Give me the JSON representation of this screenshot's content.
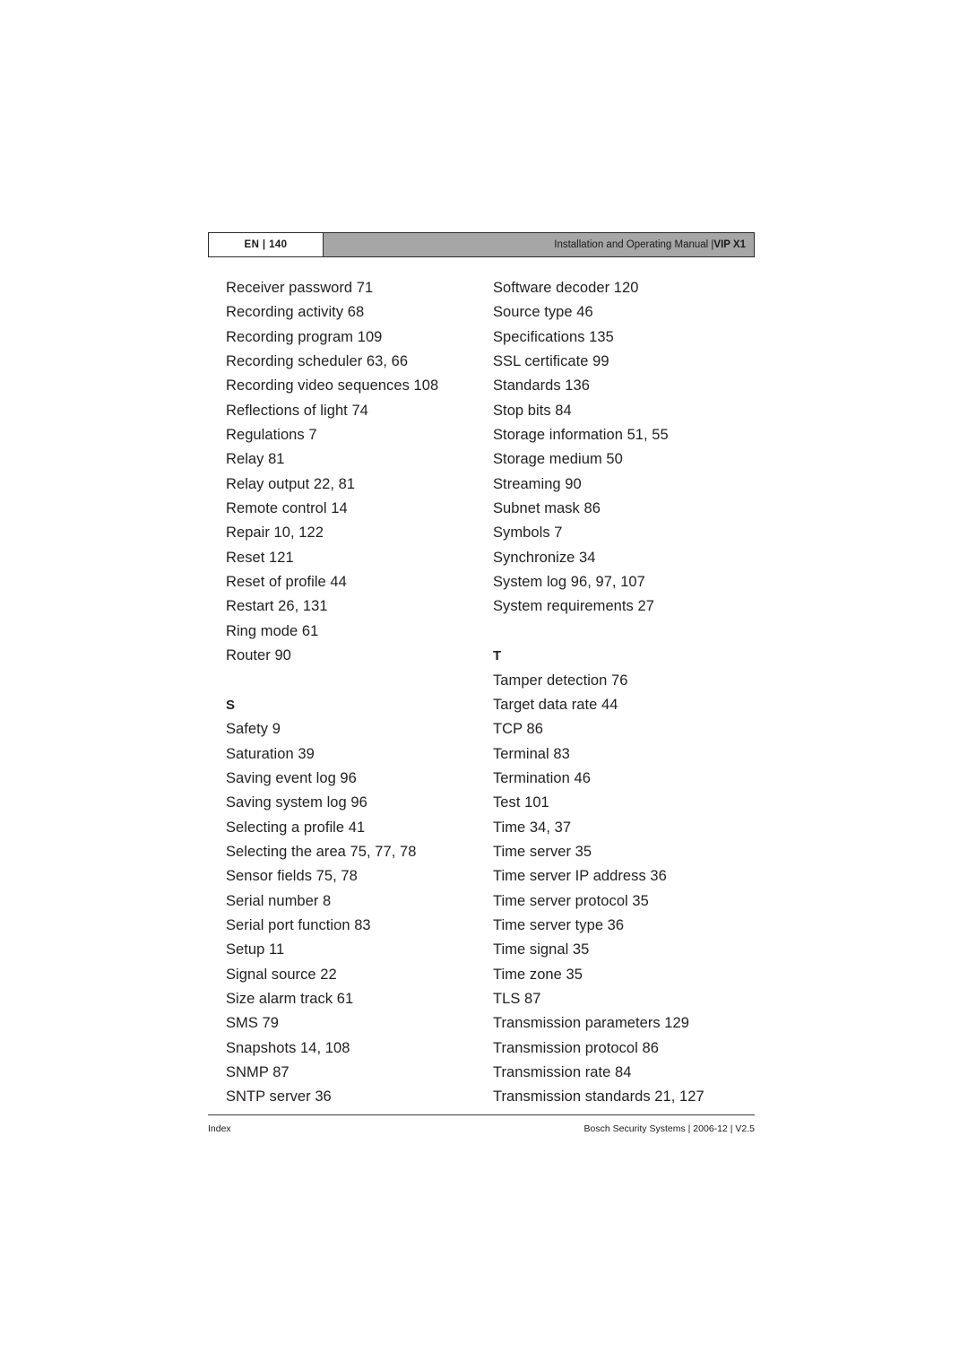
{
  "header": {
    "language_page": "EN | 140",
    "manual_title": "Installation and Operating Manual |",
    "product": "VIP X1"
  },
  "index": {
    "left_column": [
      {
        "type": "entry",
        "text": "Receiver password 71"
      },
      {
        "type": "entry",
        "text": "Recording activity 68"
      },
      {
        "type": "entry",
        "text": "Recording program 109"
      },
      {
        "type": "entry",
        "text": "Recording scheduler 63, 66"
      },
      {
        "type": "entry",
        "text": "Recording video sequences 108"
      },
      {
        "type": "entry",
        "text": "Reflections of light 74"
      },
      {
        "type": "entry",
        "text": "Regulations 7"
      },
      {
        "type": "entry",
        "text": "Relay 81"
      },
      {
        "type": "entry",
        "text": "Relay output 22, 81"
      },
      {
        "type": "entry",
        "text": "Remote control 14"
      },
      {
        "type": "entry",
        "text": "Repair 10, 122"
      },
      {
        "type": "entry",
        "text": "Reset 121"
      },
      {
        "type": "entry",
        "text": "Reset of profile 44"
      },
      {
        "type": "entry",
        "text": "Restart 26, 131"
      },
      {
        "type": "entry",
        "text": "Ring mode 61"
      },
      {
        "type": "entry",
        "text": "Router 90"
      },
      {
        "type": "heading",
        "text": "S"
      },
      {
        "type": "entry",
        "text": "Safety 9"
      },
      {
        "type": "entry",
        "text": "Saturation 39"
      },
      {
        "type": "entry",
        "text": "Saving event log 96"
      },
      {
        "type": "entry",
        "text": "Saving system log 96"
      },
      {
        "type": "entry",
        "text": "Selecting a profile 41"
      },
      {
        "type": "entry",
        "text": "Selecting the area 75, 77, 78"
      },
      {
        "type": "entry",
        "text": "Sensor fields 75, 78"
      },
      {
        "type": "entry",
        "text": "Serial number 8"
      },
      {
        "type": "entry",
        "text": "Serial port function 83"
      },
      {
        "type": "entry",
        "text": "Setup 11"
      },
      {
        "type": "entry",
        "text": "Signal source 22"
      },
      {
        "type": "entry",
        "text": "Size alarm track 61"
      },
      {
        "type": "entry",
        "text": "SMS 79"
      },
      {
        "type": "entry",
        "text": "Snapshots 14, 108"
      },
      {
        "type": "entry",
        "text": "SNMP 87"
      },
      {
        "type": "entry",
        "text": "SNTP server 36"
      }
    ],
    "right_column": [
      {
        "type": "entry",
        "text": "Software decoder 120"
      },
      {
        "type": "entry",
        "text": "Source type 46"
      },
      {
        "type": "entry",
        "text": "Specifications 135"
      },
      {
        "type": "entry",
        "text": "SSL certificate 99"
      },
      {
        "type": "entry",
        "text": "Standards 136"
      },
      {
        "type": "entry",
        "text": "Stop bits 84"
      },
      {
        "type": "entry",
        "text": "Storage information 51, 55"
      },
      {
        "type": "entry",
        "text": "Storage medium 50"
      },
      {
        "type": "entry",
        "text": "Streaming 90"
      },
      {
        "type": "entry",
        "text": "Subnet mask 86"
      },
      {
        "type": "entry",
        "text": "Symbols 7"
      },
      {
        "type": "entry",
        "text": "Synchronize 34"
      },
      {
        "type": "entry",
        "text": "System log 96, 97, 107"
      },
      {
        "type": "entry",
        "text": "System requirements 27"
      },
      {
        "type": "heading",
        "text": "T"
      },
      {
        "type": "entry",
        "text": "Tamper detection 76"
      },
      {
        "type": "entry",
        "text": "Target data rate 44"
      },
      {
        "type": "entry",
        "text": "TCP 86"
      },
      {
        "type": "entry",
        "text": "Terminal 83"
      },
      {
        "type": "entry",
        "text": "Termination 46"
      },
      {
        "type": "entry",
        "text": "Test 101"
      },
      {
        "type": "entry",
        "text": "Time 34, 37"
      },
      {
        "type": "entry",
        "text": "Time server 35"
      },
      {
        "type": "entry",
        "text": "Time server IP address 36"
      },
      {
        "type": "entry",
        "text": "Time server protocol 35"
      },
      {
        "type": "entry",
        "text": "Time server type 36"
      },
      {
        "type": "entry",
        "text": "Time signal 35"
      },
      {
        "type": "entry",
        "text": "Time zone 35"
      },
      {
        "type": "entry",
        "text": "TLS 87"
      },
      {
        "type": "entry",
        "text": "Transmission parameters 129"
      },
      {
        "type": "entry",
        "text": "Transmission protocol 86"
      },
      {
        "type": "entry",
        "text": "Transmission rate 84"
      },
      {
        "type": "entry",
        "text": "Transmission standards 21, 127"
      }
    ]
  },
  "footer": {
    "section": "Index",
    "imprint": "Bosch Security Systems | 2006-12 | V2.5"
  },
  "colors": {
    "header_bar": "#a6a6a6",
    "text": "#231f20",
    "rule": "#3a3a3a"
  }
}
